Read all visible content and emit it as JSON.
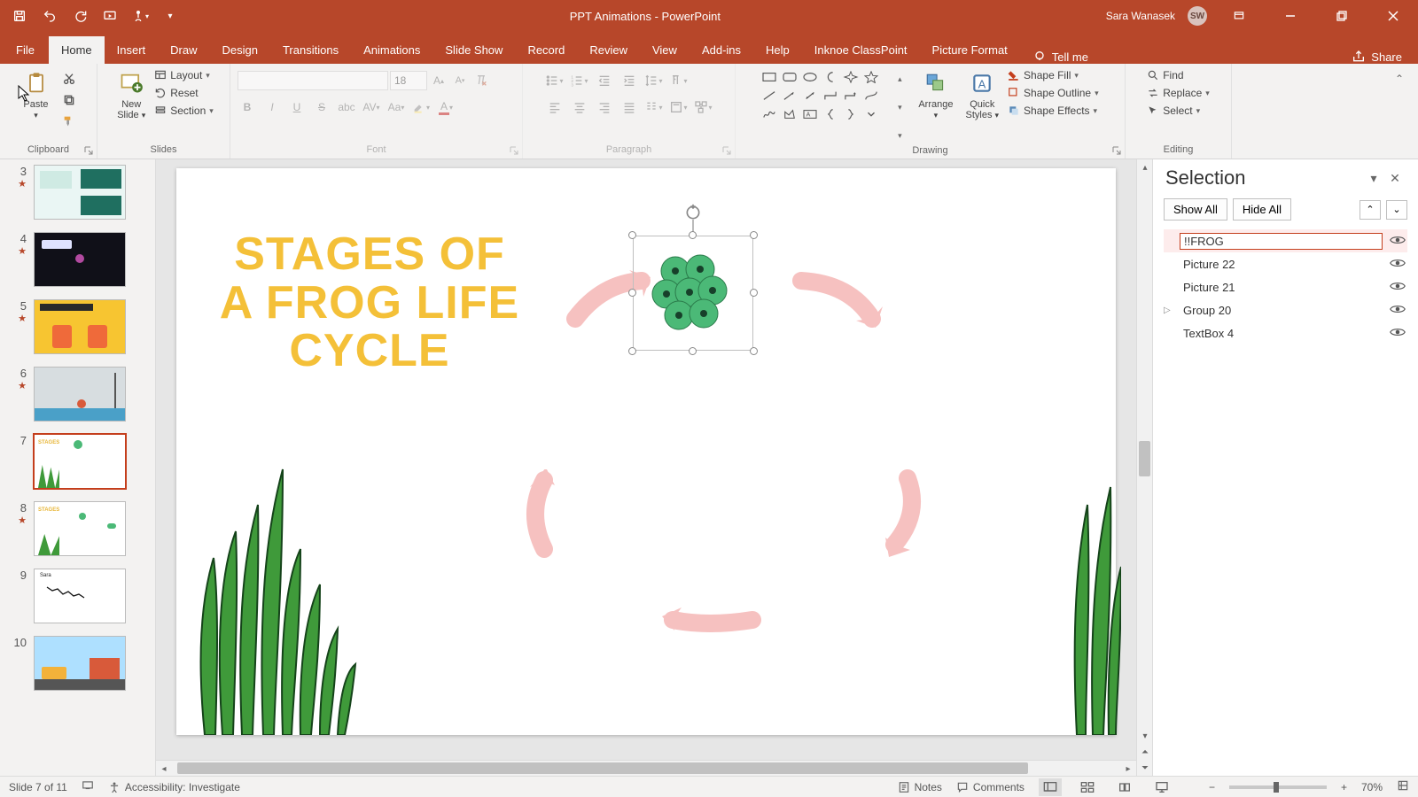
{
  "titlebar": {
    "doc_title": "PPT Animations  -  PowerPoint",
    "user_name": "Sara Wanasek",
    "user_initials": "SW"
  },
  "ribbon_tabs": {
    "file": "File",
    "home": "Home",
    "insert": "Insert",
    "draw": "Draw",
    "design": "Design",
    "transitions": "Transitions",
    "animations": "Animations",
    "slideshow": "Slide Show",
    "record": "Record",
    "review": "Review",
    "view": "View",
    "addins": "Add-ins",
    "help": "Help",
    "inknoe": "Inknoe ClassPoint",
    "picture_format": "Picture Format",
    "tell_me": "Tell me",
    "share": "Share"
  },
  "ribbon": {
    "clipboard": {
      "label": "Clipboard",
      "paste": "Paste"
    },
    "slides": {
      "label": "Slides",
      "new_slide": "New\nSlide",
      "layout": "Layout",
      "reset": "Reset",
      "section": "Section"
    },
    "font": {
      "label": "Font",
      "size": "18"
    },
    "paragraph": {
      "label": "Paragraph"
    },
    "drawing": {
      "label": "Drawing",
      "arrange": "Arrange",
      "quick_styles": "Quick\nStyles",
      "shape_fill": "Shape Fill",
      "shape_outline": "Shape Outline",
      "shape_effects": "Shape Effects"
    },
    "editing": {
      "label": "Editing",
      "find": "Find",
      "replace": "Replace",
      "select": "Select"
    }
  },
  "thumbs": [
    {
      "num": "3",
      "star": true
    },
    {
      "num": "4",
      "star": true
    },
    {
      "num": "5",
      "star": true
    },
    {
      "num": "6",
      "star": true
    },
    {
      "num": "7",
      "star": false,
      "selected": true
    },
    {
      "num": "8",
      "star": true
    },
    {
      "num": "9",
      "star": false
    },
    {
      "num": "10",
      "star": false
    }
  ],
  "slide": {
    "title": "STAGES OF A FROG LIFE CYCLE"
  },
  "selection_pane": {
    "title": "Selection",
    "show_all": "Show All",
    "hide_all": "Hide All",
    "items": [
      {
        "name": "!!FROG",
        "editing": true,
        "visible": true
      },
      {
        "name": "Picture 22",
        "editing": false,
        "visible": true
      },
      {
        "name": "Picture 21",
        "editing": false,
        "visible": true
      },
      {
        "name": "Group 20",
        "editing": false,
        "visible": true,
        "expandable": true
      },
      {
        "name": "TextBox 4",
        "editing": false,
        "visible": true
      }
    ]
  },
  "statusbar": {
    "slide_counter": "Slide 7 of 11",
    "accessibility": "Accessibility: Investigate",
    "notes": "Notes",
    "comments": "Comments",
    "zoom": "70%"
  }
}
